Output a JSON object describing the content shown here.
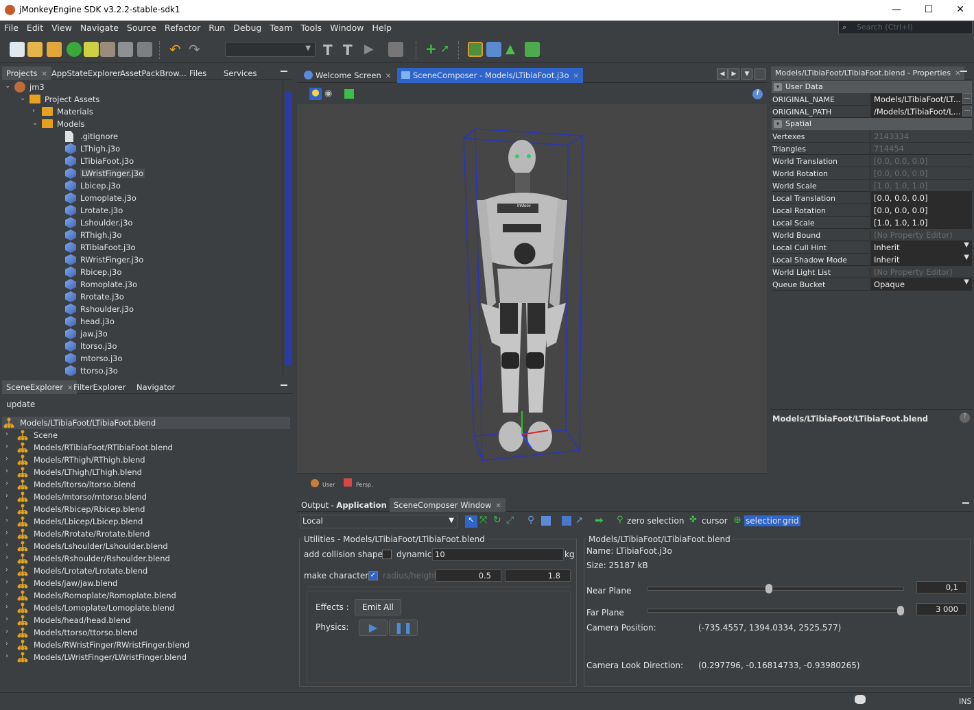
{
  "window": {
    "title": "jMonkeyEngine SDK v3.2.2-stable-sdk1",
    "min": "—",
    "max": "☐",
    "close": "✕"
  },
  "menu": [
    "File",
    "Edit",
    "View",
    "Navigate",
    "Source",
    "Refactor",
    "Run",
    "Debug",
    "Team",
    "Tools",
    "Window",
    "Help"
  ],
  "search": {
    "placeholder": "Search (Ctrl+I)"
  },
  "projects_panel": {
    "tabs": [
      "Projects",
      "AppStateExplorer",
      "AssetPackBrow...",
      "Files",
      "Services"
    ],
    "tree": [
      {
        "label": "jm3",
        "level": 0,
        "icon": "project-icon"
      },
      {
        "label": "Project Assets",
        "level": 1,
        "icon": "folder-icon"
      },
      {
        "label": "Materials",
        "level": 2,
        "icon": "folder-icon"
      },
      {
        "label": "Models",
        "level": 2,
        "icon": "folder-icon"
      },
      {
        "label": ".gitignore",
        "level": 3,
        "icon": "file-icon"
      },
      {
        "label": "LThigh.j3o",
        "level": 3,
        "icon": "model-icon"
      },
      {
        "label": "LTibiaFoot.j3o",
        "level": 3,
        "icon": "model-icon"
      },
      {
        "label": "LWristFinger.j3o",
        "level": 3,
        "icon": "model-icon",
        "selected": true
      },
      {
        "label": "Lbicep.j3o",
        "level": 3,
        "icon": "model-icon"
      },
      {
        "label": "Lomoplate.j3o",
        "level": 3,
        "icon": "model-icon"
      },
      {
        "label": "Lrotate.j3o",
        "level": 3,
        "icon": "model-icon"
      },
      {
        "label": "Lshoulder.j3o",
        "level": 3,
        "icon": "model-icon"
      },
      {
        "label": "RThigh.j3o",
        "level": 3,
        "icon": "model-icon"
      },
      {
        "label": "RTibiaFoot.j3o",
        "level": 3,
        "icon": "model-icon"
      },
      {
        "label": "RWristFinger.j3o",
        "level": 3,
        "icon": "model-icon"
      },
      {
        "label": "Rbicep.j3o",
        "level": 3,
        "icon": "model-icon"
      },
      {
        "label": "Romoplate.j3o",
        "level": 3,
        "icon": "model-icon"
      },
      {
        "label": "Rrotate.j3o",
        "level": 3,
        "icon": "model-icon"
      },
      {
        "label": "Rshoulder.j3o",
        "level": 3,
        "icon": "model-icon"
      },
      {
        "label": "head.j3o",
        "level": 3,
        "icon": "model-icon"
      },
      {
        "label": "jaw.j3o",
        "level": 3,
        "icon": "model-icon"
      },
      {
        "label": "ltorso.j3o",
        "level": 3,
        "icon": "model-icon"
      },
      {
        "label": "mtorso.j3o",
        "level": 3,
        "icon": "model-icon"
      },
      {
        "label": "ttorso.j3o",
        "level": 3,
        "icon": "model-icon"
      }
    ]
  },
  "scene_panel": {
    "tabs": [
      "SceneExplorer",
      "FilterExplorer",
      "Navigator"
    ],
    "update_label": "update",
    "root": "Models/LTibiaFoot/LTibiaFoot.blend",
    "nodes": [
      "Scene",
      "Models/RTibiaFoot/RTibiaFoot.blend",
      "Models/RThigh/RThigh.blend",
      "Models/LThigh/LThigh.blend",
      "Models/ltorso/ltorso.blend",
      "Models/mtorso/mtorso.blend",
      "Models/Rbicep/Rbicep.blend",
      "Models/Lbicep/Lbicep.blend",
      "Models/Rrotate/Rrotate.blend",
      "Models/Lshoulder/Lshoulder.blend",
      "Models/Rshoulder/Rshoulder.blend",
      "Models/Lrotate/Lrotate.blend",
      "Models/jaw/jaw.blend",
      "Models/Romoplate/Romoplate.blend",
      "Models/Lomoplate/Lomoplate.blend",
      "Models/head/head.blend",
      "Models/ttorso/ttorso.blend",
      "Models/RWristFinger/RWristFinger.blend",
      "Models/LWristFinger/LWristFinger.blend"
    ]
  },
  "editor": {
    "tabs": [
      "Welcome Screen",
      "SceneComposer - Models/LTibiaFoot.j3o"
    ],
    "viewport_user": "User",
    "viewport_persp": "Persp.",
    "robot_chest_text": "InMoov"
  },
  "properties": {
    "title": "Models/LTibiaFoot/LTibiaFoot.blend - Properties",
    "categories": [
      "User Data",
      "Spatial"
    ],
    "userdata": [
      {
        "k": "ORIGINAL_NAME",
        "v": "Models/LTibiaFoot/LT..."
      },
      {
        "k": "ORIGINAL_PATH",
        "v": "/Models/LTibiaFoot/L..."
      }
    ],
    "spatial": [
      {
        "k": "Vertexes",
        "v": "2143334",
        "dim": true
      },
      {
        "k": "Triangles",
        "v": "714454",
        "dim": true
      },
      {
        "k": "World Translation",
        "v": "[0.0, 0.0, 0.0]",
        "dim": true
      },
      {
        "k": "World Rotation",
        "v": "[0.0, 0.0, 0.0]",
        "dim": true
      },
      {
        "k": "World Scale",
        "v": "[1.0, 1.0, 1.0]",
        "dim": true
      },
      {
        "k": "Local Translation",
        "v": "[0.0, 0.0, 0.0]"
      },
      {
        "k": "Local Rotation",
        "v": "[0.0, 0.0, 0.0]"
      },
      {
        "k": "Local Scale",
        "v": "[1.0, 1.0, 1.0]"
      },
      {
        "k": "World Bound",
        "v": "(No Property Editor)",
        "dim": true
      },
      {
        "k": "Local Cull Hint",
        "v": "Inherit",
        "dd": true
      },
      {
        "k": "Local Shadow Mode",
        "v": "Inherit",
        "dd": true
      },
      {
        "k": "World Light List",
        "v": "(No Property Editor)",
        "dim": true
      },
      {
        "k": "Queue Bucket",
        "v": "Opaque",
        "dd": true
      }
    ],
    "description_title": "Models/LTibiaFoot/LTibiaFoot.blend"
  },
  "bottom": {
    "tabs": [
      "Output - ",
      "Application",
      "SceneComposer Window"
    ],
    "mode_select": "Local",
    "zero_selection": "zero selection",
    "cursor": "cursor",
    "selection": "selection",
    "grid": "grid",
    "utilities_title": "Utilities - Models/LTibiaFoot/LTibiaFoot.blend",
    "add_collision": "add collision shape",
    "dynamic": "dynamic:",
    "dynamic_value": "10",
    "kg": "kg",
    "make_character": "make character",
    "radius_height": "radius/height",
    "radius": "0.5",
    "height": "1.8",
    "effects": "Effects :",
    "emit_all": "Emit All",
    "physics": "Physics:",
    "info_title": "Models/LTibiaFoot/LTibiaFoot.blend",
    "name": "Name: LTibiaFoot.j3o",
    "size": "Size: 25187 kB",
    "near_plane": "Near Plane",
    "near_value": "0,1",
    "near_slider": 0.47,
    "far_plane": "Far Plane",
    "far_value": "3 000",
    "far_slider": 1.0,
    "camera_position_label": "Camera Position:",
    "camera_position": "(-735.4557, 1394.0334, 2525.577)",
    "camera_look_label": "Camera Look Direction:",
    "camera_look": "(0.297796, -0.16814733, -0.93980265)"
  },
  "status": {
    "ins": "INS"
  },
  "colors": {
    "accent": "#2d3aa6",
    "bg": "#3c3f41",
    "selection_blue": "#2f65ca",
    "viewport": "#464646"
  }
}
